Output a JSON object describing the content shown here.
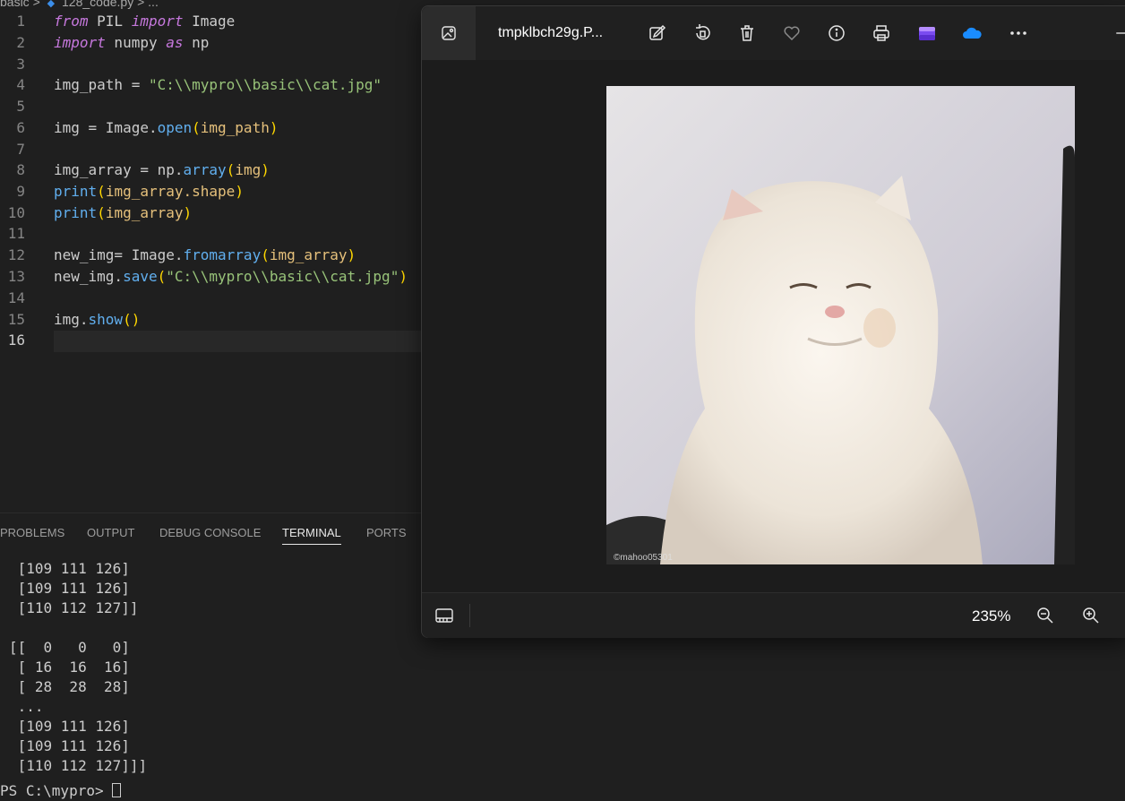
{
  "breadcrumb": {
    "folder": "basic",
    "sep": ">",
    "file": "128_code.py",
    "more": "..."
  },
  "editor": {
    "lines": [
      {
        "n": "1",
        "tokens": [
          [
            "kw",
            "from"
          ],
          [
            "dim",
            " PIL "
          ],
          [
            "kw",
            "import"
          ],
          [
            "dim",
            " Image"
          ]
        ]
      },
      {
        "n": "2",
        "tokens": [
          [
            "kw",
            "import"
          ],
          [
            "dim",
            " numpy "
          ],
          [
            "kw",
            "as"
          ],
          [
            "dim",
            " np"
          ]
        ]
      },
      {
        "n": "3",
        "tokens": []
      },
      {
        "n": "4",
        "tokens": [
          [
            "dim",
            "img_path = "
          ],
          [
            "str",
            "\"C:\\\\mypro\\\\basic\\\\cat.jpg\""
          ]
        ]
      },
      {
        "n": "5",
        "tokens": []
      },
      {
        "n": "6",
        "tokens": [
          [
            "dim",
            "img = Image."
          ],
          [
            "fn",
            "open"
          ],
          [
            "paren",
            "("
          ],
          [
            "var",
            "img_path"
          ],
          [
            "paren",
            ")"
          ]
        ]
      },
      {
        "n": "7",
        "tokens": []
      },
      {
        "n": "8",
        "tokens": [
          [
            "dim",
            "img_array = np."
          ],
          [
            "fn",
            "array"
          ],
          [
            "paren",
            "("
          ],
          [
            "var",
            "img"
          ],
          [
            "paren",
            ")"
          ]
        ]
      },
      {
        "n": "9",
        "tokens": [
          [
            "fn",
            "print"
          ],
          [
            "paren",
            "("
          ],
          [
            "var",
            "img_array.shape"
          ],
          [
            "paren",
            ")"
          ]
        ]
      },
      {
        "n": "10",
        "tokens": [
          [
            "fn",
            "print"
          ],
          [
            "paren",
            "("
          ],
          [
            "var",
            "img_array"
          ],
          [
            "paren",
            ")"
          ]
        ]
      },
      {
        "n": "11",
        "tokens": []
      },
      {
        "n": "12",
        "tokens": [
          [
            "dim",
            "new_img= Image."
          ],
          [
            "fn",
            "fromarray"
          ],
          [
            "paren",
            "("
          ],
          [
            "var",
            "img_array"
          ],
          [
            "paren",
            ")"
          ]
        ]
      },
      {
        "n": "13",
        "tokens": [
          [
            "dim",
            "new_img."
          ],
          [
            "fn",
            "save"
          ],
          [
            "paren",
            "("
          ],
          [
            "str",
            "\"C:\\\\mypro\\\\basic\\\\cat.jpg\""
          ],
          [
            "paren",
            ")"
          ]
        ]
      },
      {
        "n": "14",
        "tokens": []
      },
      {
        "n": "15",
        "tokens": [
          [
            "dim",
            "img."
          ],
          [
            "fn",
            "show"
          ],
          [
            "paren",
            "()"
          ]
        ]
      },
      {
        "n": "16",
        "tokens": []
      }
    ]
  },
  "panel_tabs": [
    {
      "label": "PROBLEMS",
      "active": false
    },
    {
      "label": "OUTPUT",
      "active": false
    },
    {
      "label": "DEBUG CONSOLE",
      "active": false
    },
    {
      "label": "TERMINAL",
      "active": true
    },
    {
      "label": "PORTS",
      "active": false
    }
  ],
  "terminal": {
    "lines": [
      " [109 111 126]",
      " [109 111 126]",
      " [110 112 127]]",
      "",
      "[[  0   0   0]",
      " [ 16  16  16]",
      " [ 28  28  28]",
      " ...",
      " [109 111 126]",
      " [109 111 126]",
      " [110 112 127]]]"
    ],
    "prompt": "PS C:\\mypro> "
  },
  "photos": {
    "title": "tmpklbch29g.P...",
    "toolbar_icons": [
      "edit-image-icon",
      "rotate-icon",
      "delete-icon",
      "favorite-heart-icon",
      "info-icon",
      "print-icon",
      "clipchamp-icon",
      "onedrive-cloud-icon",
      "more-options-icon"
    ],
    "watermark": "©mahoo05301",
    "zoom": "235%",
    "colors": {
      "clipchamp": "#7a4cf0",
      "onedrive": "#1a8cff"
    }
  }
}
